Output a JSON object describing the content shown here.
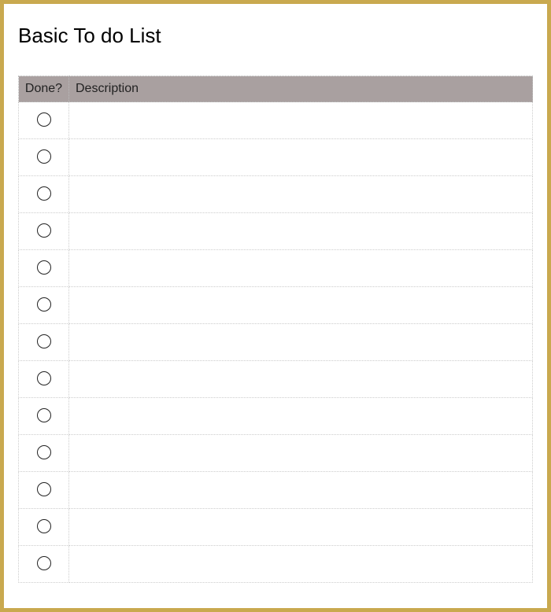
{
  "title": "Basic To do List",
  "headers": {
    "done": "Done?",
    "description": "Description"
  },
  "rows": [
    {
      "done": false,
      "description": ""
    },
    {
      "done": false,
      "description": ""
    },
    {
      "done": false,
      "description": ""
    },
    {
      "done": false,
      "description": ""
    },
    {
      "done": false,
      "description": ""
    },
    {
      "done": false,
      "description": ""
    },
    {
      "done": false,
      "description": ""
    },
    {
      "done": false,
      "description": ""
    },
    {
      "done": false,
      "description": ""
    },
    {
      "done": false,
      "description": ""
    },
    {
      "done": false,
      "description": ""
    },
    {
      "done": false,
      "description": ""
    },
    {
      "done": false,
      "description": ""
    }
  ]
}
